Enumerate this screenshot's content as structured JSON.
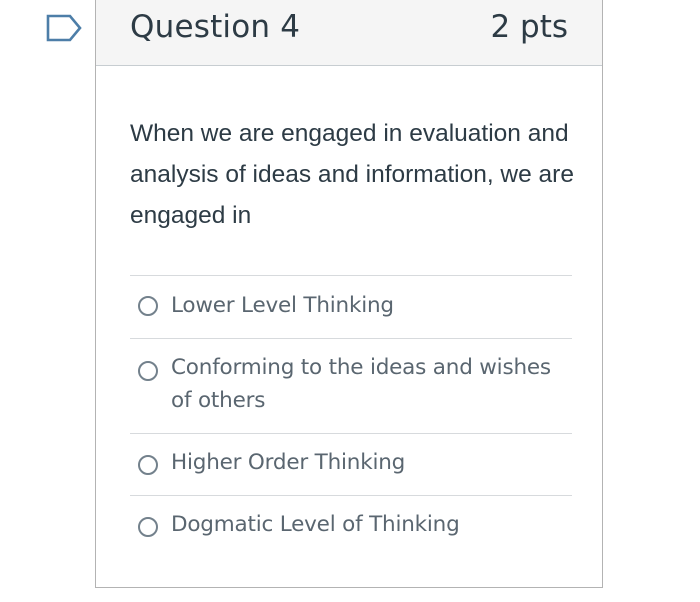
{
  "question": {
    "title": "Question 4",
    "points": "2 pts",
    "text": "When we are engaged in evaluation and analysis of ideas and information, we are engaged in"
  },
  "answers": [
    {
      "label": "Lower Level Thinking",
      "selected": false
    },
    {
      "label": "Conforming to the ideas and wishes of others",
      "selected": false
    },
    {
      "label": "Higher Order Thinking",
      "selected": false
    },
    {
      "label": "Dogmatic Level of Thinking",
      "selected": false
    }
  ],
  "colors": {
    "flag": "#4d7ea8",
    "header_bg": "#f5f5f5",
    "text": "#2d3b45",
    "answer_text": "#5a6670"
  },
  "icons": {
    "flag": "bookmark-flag-icon"
  }
}
